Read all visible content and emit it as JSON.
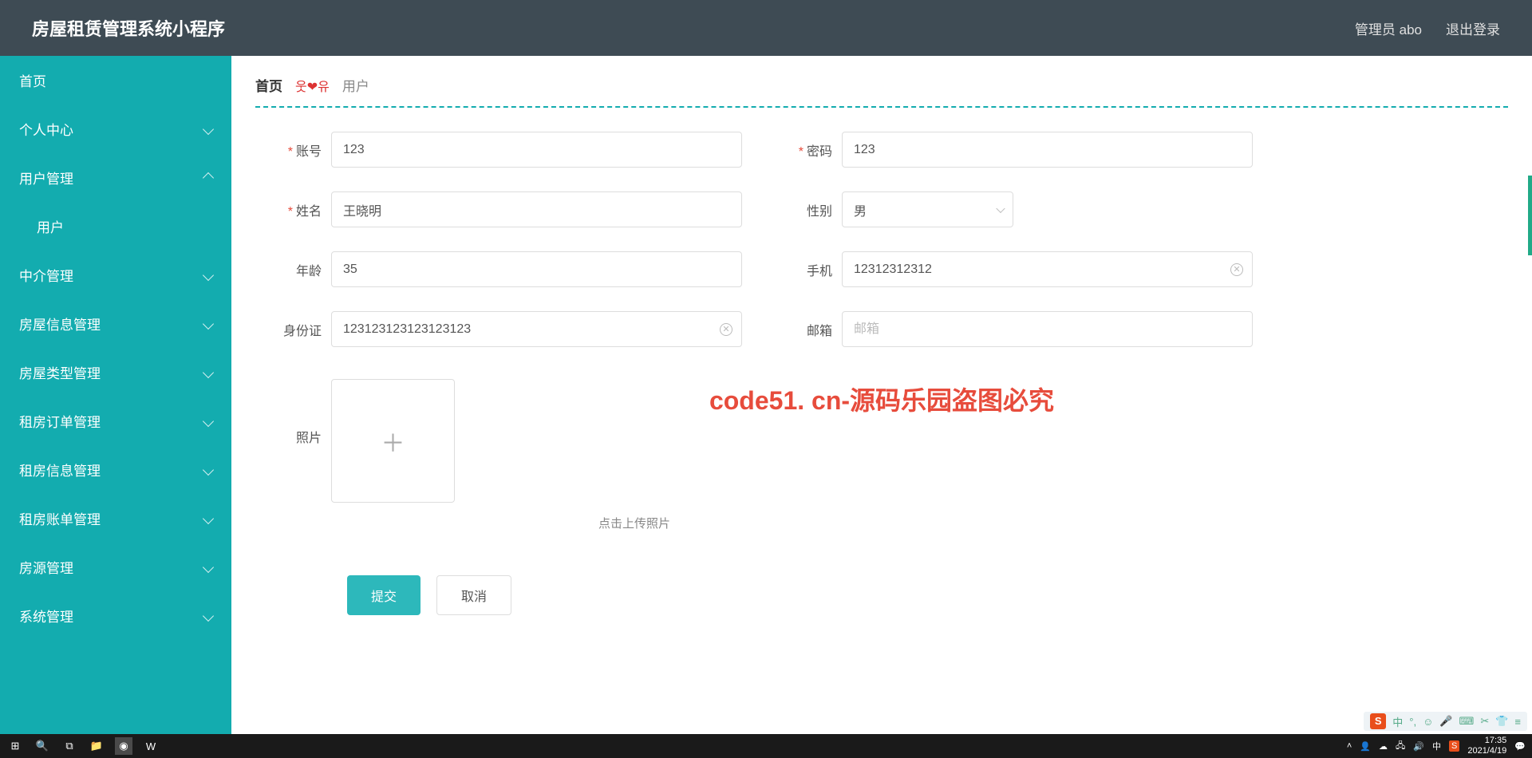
{
  "header": {
    "title": "房屋租赁管理系统小程序",
    "user": "管理员 abo",
    "logout": "退出登录"
  },
  "sidebar": {
    "items": [
      {
        "label": "首页",
        "expandable": false
      },
      {
        "label": "个人中心",
        "expandable": true,
        "open": false
      },
      {
        "label": "用户管理",
        "expandable": true,
        "open": true
      },
      {
        "label": "用户",
        "sub": true
      },
      {
        "label": "中介管理",
        "expandable": true,
        "open": false
      },
      {
        "label": "房屋信息管理",
        "expandable": true,
        "open": false
      },
      {
        "label": "房屋类型管理",
        "expandable": true,
        "open": false
      },
      {
        "label": "租房订单管理",
        "expandable": true,
        "open": false
      },
      {
        "label": "租房信息管理",
        "expandable": true,
        "open": false
      },
      {
        "label": "租房账单管理",
        "expandable": true,
        "open": false
      },
      {
        "label": "房源管理",
        "expandable": true,
        "open": false
      },
      {
        "label": "系统管理",
        "expandable": true,
        "open": false
      }
    ]
  },
  "breadcrumb": {
    "home": "首页",
    "icon": "웃❤유",
    "current": "用户"
  },
  "form": {
    "account": {
      "label": "账号",
      "value": "123"
    },
    "password": {
      "label": "密码",
      "value": "123"
    },
    "name": {
      "label": "姓名",
      "value": "王晓明"
    },
    "gender": {
      "label": "性别",
      "value": "男"
    },
    "age": {
      "label": "年龄",
      "value": "35"
    },
    "phone": {
      "label": "手机",
      "value": "12312312312"
    },
    "idcard": {
      "label": "身份证",
      "value": "123123123123123123"
    },
    "email": {
      "label": "邮箱",
      "value": "",
      "placeholder": "邮箱"
    },
    "photo": {
      "label": "照片",
      "hint": "点击上传照片"
    }
  },
  "buttons": {
    "submit": "提交",
    "cancel": "取消"
  },
  "watermark": "code51. cn-源码乐园盗图必究",
  "taskbar": {
    "time": "17:35",
    "date": "2021/4/19",
    "lang": "中"
  },
  "ime": {
    "logo": "S",
    "lang": "中"
  }
}
